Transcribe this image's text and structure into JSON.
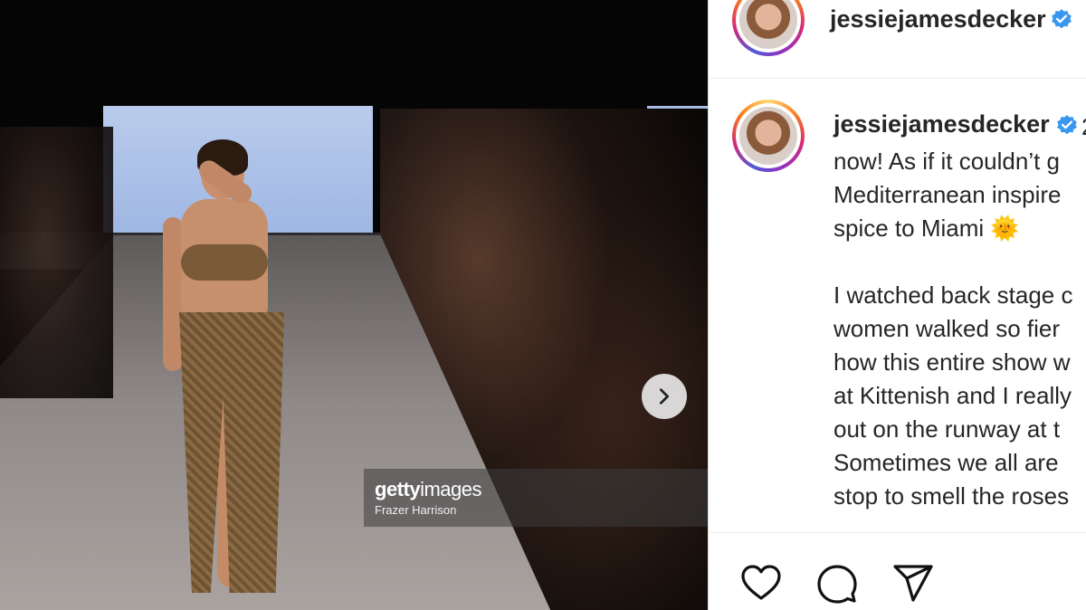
{
  "post": {
    "username": "jessiejamesdecker",
    "verified": true,
    "caption_lines": [
      "now! As if it couldn’t g",
      "Mediterranean inspire",
      "spice to Miami",
      "",
      "I watched back stage c",
      "women walked so fier",
      "how this entire show w",
      "at Kittenish and I really",
      "out on the runway at t",
      "Sometimes we all are",
      "stop to smell the roses"
    ],
    "caption_head_suffix": "2",
    "sun_emoji": "🌞"
  },
  "watermark": {
    "brand_bold": "getty",
    "brand_light": "images",
    "credit": "Frazer Harrison"
  },
  "icons": {
    "next": "chevron-right-icon",
    "like": "heart-icon",
    "comment": "comment-icon",
    "share": "paper-plane-icon",
    "verified": "verified-badge-icon"
  },
  "colors": {
    "verified_blue": "#3897f0",
    "text": "#262626"
  }
}
